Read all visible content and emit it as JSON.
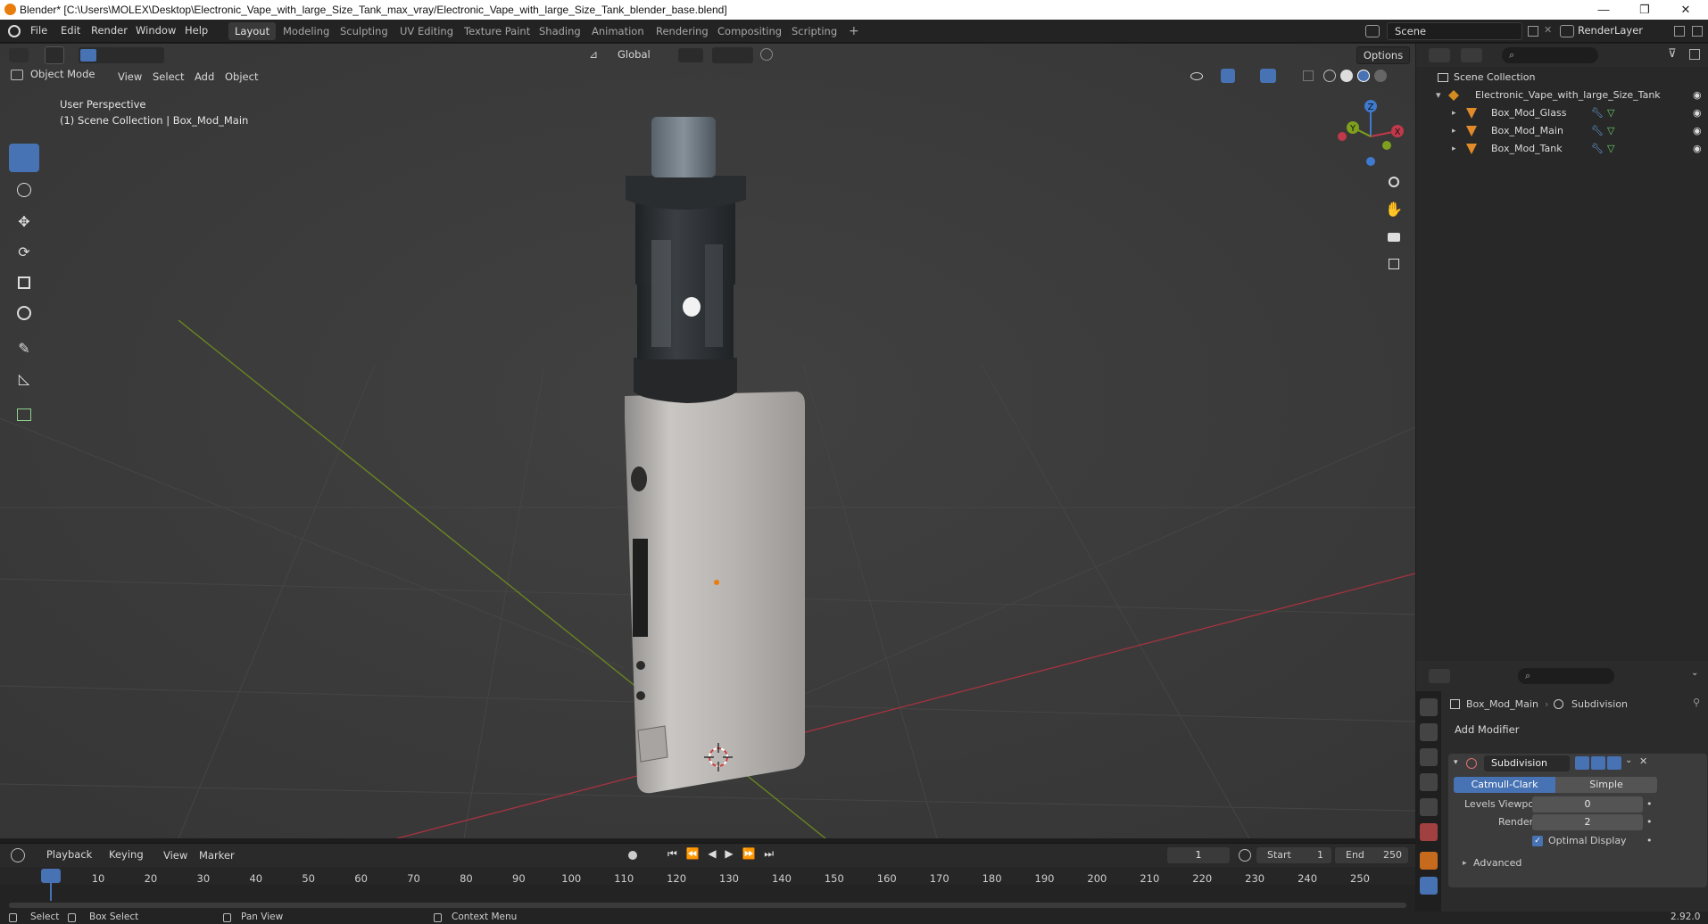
{
  "titlebar": {
    "title": "Blender* [C:\\Users\\MOLEX\\Desktop\\Electronic_Vape_with_large_Size_Tank_max_vray/Electronic_Vape_with_large_Size_Tank_blender_base.blend]",
    "minimize": "—",
    "maximize": "❐",
    "close": "✕"
  },
  "menu": {
    "items": [
      "File",
      "Edit",
      "Render",
      "Window",
      "Help"
    ],
    "workspaces": [
      "Layout",
      "Modeling",
      "Sculpting",
      "UV Editing",
      "Texture Paint",
      "Shading",
      "Animation",
      "Rendering",
      "Compositing",
      "Scripting"
    ],
    "add_tab": "+",
    "scene_value": "Scene",
    "renderlayer_value": "RenderLayer"
  },
  "viewport": {
    "mode": "Object Mode",
    "menus": [
      "View",
      "Select",
      "Add",
      "Object"
    ],
    "transform_orientation": "Global",
    "options_label": "Options",
    "overlay_line1": "User Perspective",
    "overlay_line2": "(1) Scene Collection | Box_Mod_Main",
    "gizmo_axes": [
      "X",
      "Y",
      "Z"
    ]
  },
  "timeline": {
    "menus": [
      "Playback",
      "Keying",
      "View",
      "Marker"
    ],
    "current_frame": "1",
    "start_label": "Start",
    "start_value": "1",
    "end_label": "End",
    "end_value": "250",
    "ticks": [
      "1",
      "10",
      "20",
      "30",
      "40",
      "50",
      "60",
      "70",
      "80",
      "90",
      "100",
      "110",
      "120",
      "130",
      "140",
      "150",
      "160",
      "170",
      "180",
      "190",
      "200",
      "210",
      "220",
      "230",
      "240",
      "250"
    ]
  },
  "outliner": {
    "root": "Scene Collection",
    "collection": "Electronic_Vape_with_large_Size_Tank",
    "objects": [
      "Box_Mod_Glass",
      "Box_Mod_Main",
      "Box_Mod_Tank"
    ]
  },
  "properties": {
    "object_name": "Box_Mod_Main",
    "modifier_context": "Subdivision",
    "add_modifier_label": "Add Modifier",
    "modifier_name": "Subdivision",
    "type_options": [
      "Catmull-Clark",
      "Simple"
    ],
    "selected_type": "Catmull-Clark",
    "levels_viewport_label": "Levels Viewport",
    "levels_viewport_value": "0",
    "render_label": "Render",
    "render_value": "2",
    "optimal_display_label": "Optimal Display",
    "optimal_display_checked": true,
    "advanced_label": "Advanced"
  },
  "statusbar": {
    "select": "Select",
    "box_select": "Box Select",
    "pan_view": "Pan View",
    "context_menu": "Context Menu",
    "version": "2.92.0"
  },
  "colors": {
    "accent": "#4772b3",
    "viewport_bg": "#3d3d3d",
    "x_axis": "#c0394a",
    "y_axis": "#7ea01e",
    "z_axis": "#3f7ad1",
    "origin": "#e87d0d"
  }
}
